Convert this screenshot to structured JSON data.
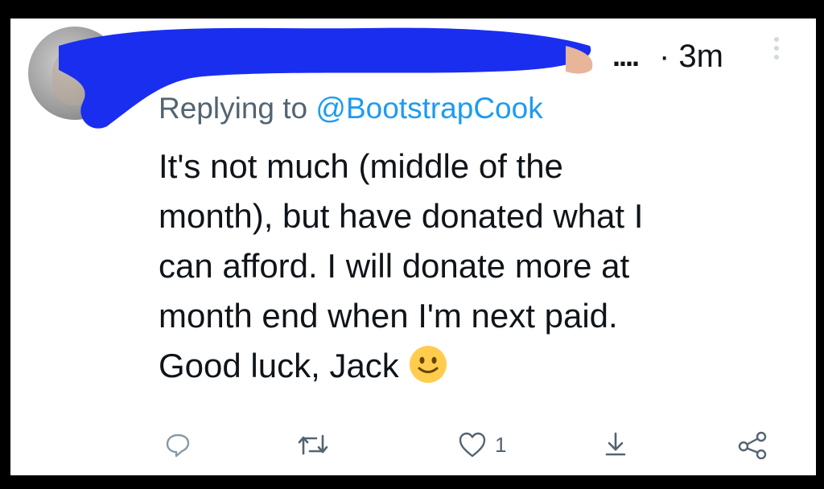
{
  "tweet": {
    "more_indicator": "....",
    "time": "· 3m",
    "replying_prefix": "Replying to ",
    "replying_handle": "@BootstrapCook",
    "text_lines": [
      "It's not much (middle of the",
      "month), but have donated what I",
      "can afford. I will donate more at",
      "month end when I'm next paid.",
      "Good luck, Jack"
    ],
    "emoji": "slightly-smiling-face"
  },
  "actions": {
    "reply_icon": "reply-icon",
    "retweet_icon": "retweet-icon",
    "like_icon": "like-icon",
    "like_count": "1",
    "share_icon": "share-icon",
    "external_share_icon": "external-share-icon"
  },
  "colors": {
    "text": "#0f1419",
    "secondary": "#536471",
    "link": "#1d9bf0",
    "redaction": "#1a2ef0"
  }
}
